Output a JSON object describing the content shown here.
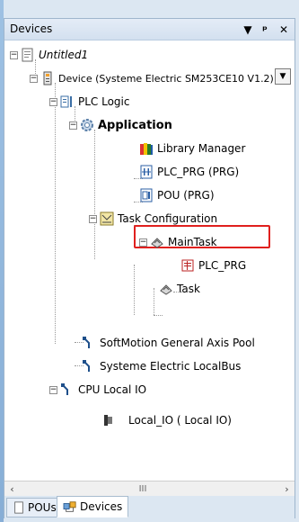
{
  "panel": {
    "title": "Devices",
    "menu_icon": "dropdown-triangle-icon",
    "pin_icon": "pin-icon",
    "close_icon": "close-icon"
  },
  "tree": [
    {
      "label": "Untitled1",
      "icon": "project-icon"
    },
    {
      "label": "Device (Systeme Electric SM253CE10 V1.2)",
      "icon": "plc-device-icon"
    },
    {
      "label": "PLC Logic",
      "icon": "plc-logic-icon"
    },
    {
      "label": "Application",
      "icon": "application-gear-icon"
    },
    {
      "label": "Library Manager",
      "icon": "library-books-icon"
    },
    {
      "label": "PLC_PRG (PRG)",
      "icon": "ladder-pou-icon"
    },
    {
      "label": "POU (PRG)",
      "icon": "pou-icon"
    },
    {
      "label": "Task Configuration",
      "icon": "task-config-icon"
    },
    {
      "label": "MainTask",
      "icon": "task-icon"
    },
    {
      "label": "PLC_PRG",
      "icon": "program-call-icon"
    },
    {
      "label": "Task",
      "icon": "task-icon"
    },
    {
      "label": "SoftMotion General Axis Pool",
      "icon": "axis-pool-icon"
    },
    {
      "label": "Systeme Electric LocalBus",
      "icon": "localbus-icon"
    },
    {
      "label": "CPU Local IO",
      "icon": "local-io-icon"
    },
    {
      "label": "Local_IO ( Local IO)",
      "icon": "io-module-icon"
    }
  ],
  "scrollbar": {
    "thumb_label": "III"
  },
  "tabs": [
    {
      "label": "POUs",
      "icon": "pou-page-icon"
    },
    {
      "label": "Devices",
      "icon": "devices-icon"
    }
  ],
  "colors": {
    "highlight": "#e0201e",
    "accent": "#dce7f2"
  }
}
